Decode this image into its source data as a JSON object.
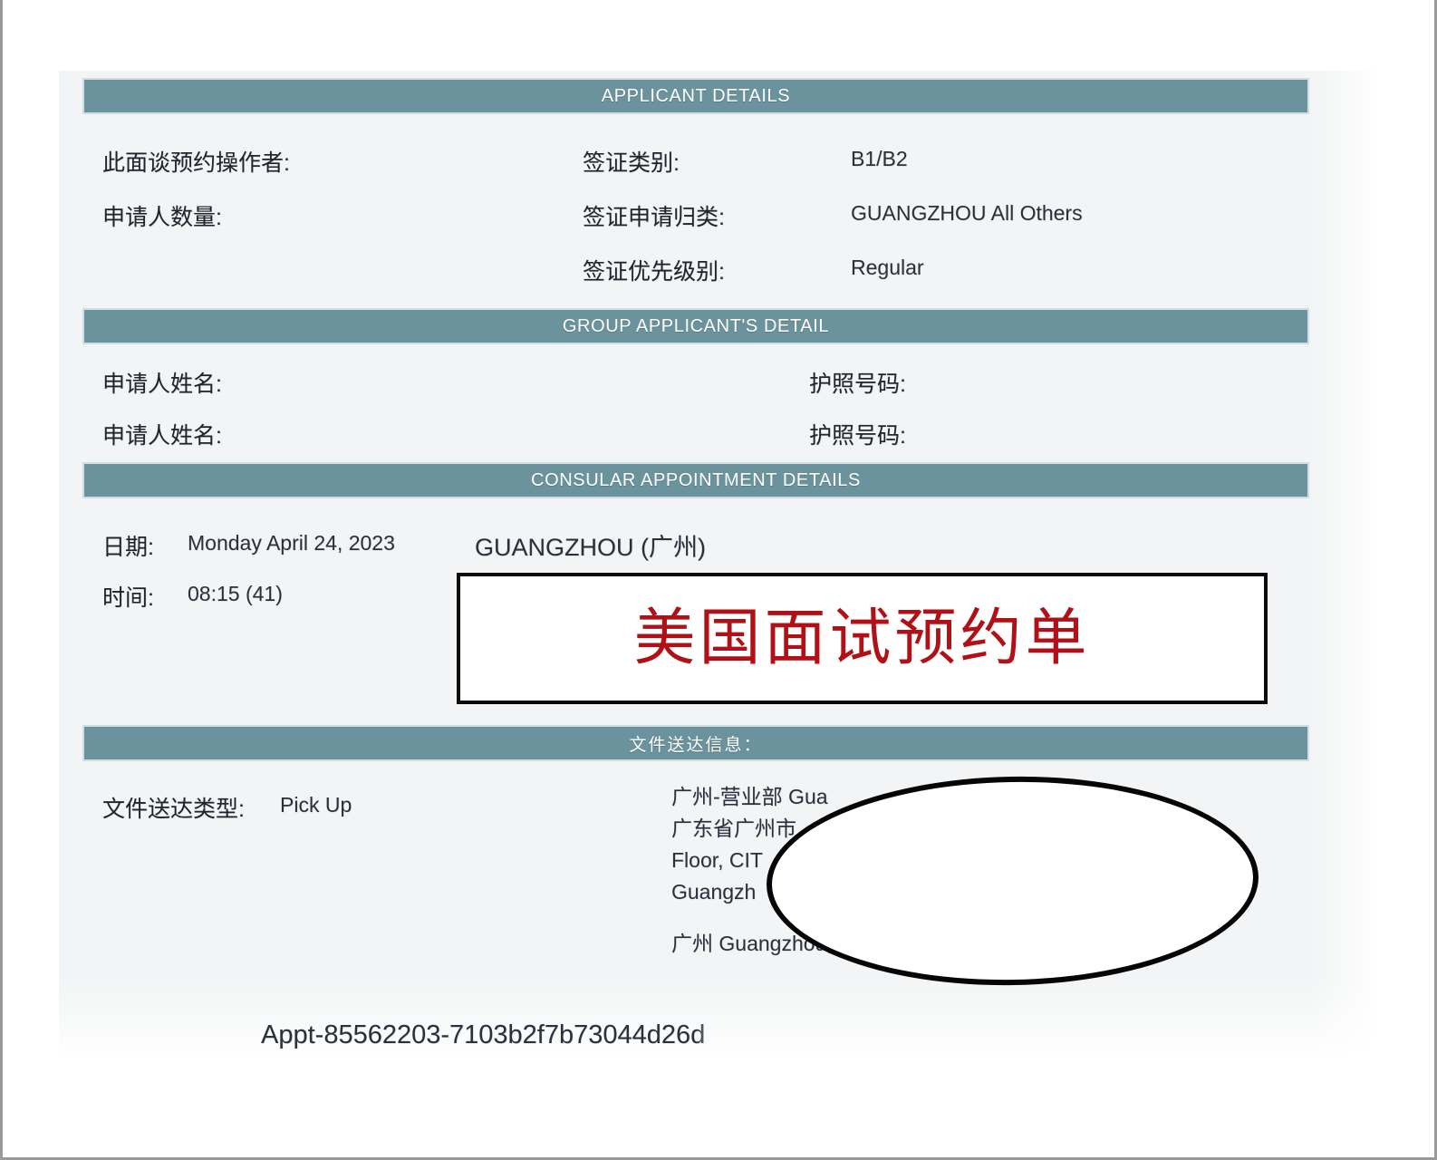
{
  "document": {
    "title_stamp": "美国面试预约单",
    "stamp_color": "#b11116",
    "header_bar_color": "#6b939d",
    "panel_background": "#f2f4f5"
  },
  "sections": {
    "applicant_details": {
      "header": "APPLICANT DETAILS",
      "left_fields": [
        {
          "label": "此面谈预约操作者:",
          "value": ""
        },
        {
          "label": "申请人数量:",
          "value": ""
        }
      ],
      "right_fields": [
        {
          "label": "签证类别:",
          "value": "B1/B2"
        },
        {
          "label": "签证申请归类:",
          "value": "GUANGZHOU All Others"
        },
        {
          "label": "签证优先级别:",
          "value": "Regular"
        }
      ]
    },
    "group_applicant": {
      "header": "GROUP APPLICANT'S DETAIL",
      "rows": [
        {
          "name_label": "申请人姓名:",
          "name_value": "",
          "passport_label": "护照号码:",
          "passport_value": ""
        },
        {
          "name_label": "申请人姓名:",
          "name_value": "",
          "passport_label": "护照号码:",
          "passport_value": ""
        }
      ]
    },
    "consular_appointment": {
      "header": "CONSULAR APPOINTMENT DETAILS",
      "date_label": "日期:",
      "date_value": "Monday April 24, 2023",
      "time_label": "时间:",
      "time_value": "08:15 (41)",
      "location": "GUANGZHOU (广州)"
    },
    "document_delivery": {
      "header": "文件送达信息：",
      "type_label": "文件送达类型:",
      "type_value": "Pick Up",
      "address_lines": [
        "广州-营业部 Gua",
        "广东省广州市",
        "Floor, CIT",
        "Guangzh"
      ],
      "address_footer": "广州 Guangzhou, G"
    }
  },
  "footer": {
    "appointment_id": "Appt-85562203-7103b2f7b73044d26d"
  }
}
